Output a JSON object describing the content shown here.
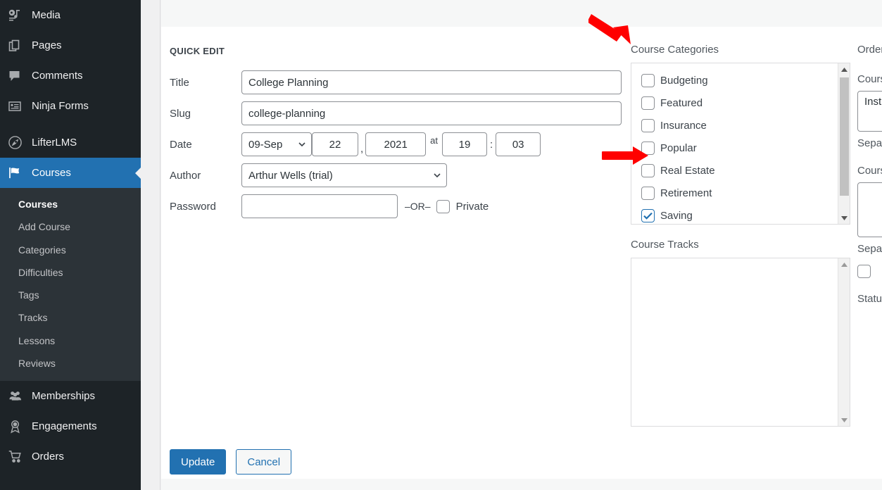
{
  "sidebar": {
    "items": [
      {
        "label": "Media",
        "icon": "media-icon",
        "active": false
      },
      {
        "label": "Pages",
        "icon": "pages-icon",
        "active": false
      },
      {
        "label": "Comments",
        "icon": "comments-icon",
        "active": false
      },
      {
        "label": "Ninja Forms",
        "icon": "ninja-forms-icon",
        "active": false
      },
      {
        "label": "LifterLMS",
        "icon": "lifterlms-icon",
        "active": false
      },
      {
        "label": "Courses",
        "icon": "courses-icon",
        "active": true
      }
    ],
    "submenu": [
      {
        "label": "Courses",
        "current": true
      },
      {
        "label": "Add Course",
        "current": false
      },
      {
        "label": "Categories",
        "current": false
      },
      {
        "label": "Difficulties",
        "current": false
      },
      {
        "label": "Tags",
        "current": false
      },
      {
        "label": "Tracks",
        "current": false
      },
      {
        "label": "Lessons",
        "current": false
      },
      {
        "label": "Reviews",
        "current": false
      }
    ],
    "items_bottom": [
      {
        "label": "Memberships",
        "icon": "memberships-icon"
      },
      {
        "label": "Engagements",
        "icon": "engagements-icon"
      },
      {
        "label": "Orders",
        "icon": "orders-icon"
      }
    ],
    "active_color": "#2271b1",
    "bg_color": "#1d2327",
    "submenu_bg_color": "#2c3338"
  },
  "quick_edit": {
    "heading": "QUICK EDIT",
    "fields": {
      "title_label": "Title",
      "title_value": "College Planning",
      "slug_label": "Slug",
      "slug_value": "college-planning",
      "date_label": "Date",
      "date_month": "09-Sep",
      "date_day": "22",
      "date_comma": ",",
      "date_year": "2021",
      "date_at": "at",
      "date_hour": "19",
      "date_colon": ":",
      "date_minute": "03",
      "author_label": "Author",
      "author_value": "Arthur Wells (trial)",
      "password_label": "Password",
      "password_value": "",
      "or_text": "–OR–",
      "private_label": "Private",
      "private_checked": false
    },
    "buttons": {
      "update": "Update",
      "cancel": "Cancel"
    }
  },
  "taxonomies": {
    "categories": {
      "title": "Course Categories",
      "items": [
        {
          "label": "Budgeting",
          "checked": false
        },
        {
          "label": "Featured",
          "checked": false
        },
        {
          "label": "Insurance",
          "checked": false
        },
        {
          "label": "Popular",
          "checked": false
        },
        {
          "label": "Real Estate",
          "checked": false
        },
        {
          "label": "Retirement",
          "checked": false
        },
        {
          "label": "Saving",
          "checked": true
        }
      ]
    },
    "tracks": {
      "title": "Course Tracks",
      "items": []
    }
  },
  "right_column": {
    "clipped_note": "column is cut off at the right edge of the screenshot",
    "lines": [
      {
        "text": "Order",
        "type": "label"
      },
      {
        "text": "Course Instructors",
        "type": "label"
      },
      {
        "text": "Instructor",
        "type": "input"
      },
      {
        "text": "Separate",
        "type": "label"
      },
      {
        "text": "Course",
        "type": "label"
      },
      {
        "text": "",
        "type": "input"
      },
      {
        "text": "Separate",
        "type": "label"
      },
      {
        "text": "",
        "type": "checkbox"
      },
      {
        "text": "Status",
        "type": "label"
      }
    ]
  },
  "annotations": {
    "arrow_color": "#ff0000",
    "arrows": [
      {
        "name": "arrow-to-course-categories",
        "points_to": "Course Categories"
      },
      {
        "name": "arrow-to-popular-checkbox",
        "points_to": "Popular"
      }
    ]
  }
}
